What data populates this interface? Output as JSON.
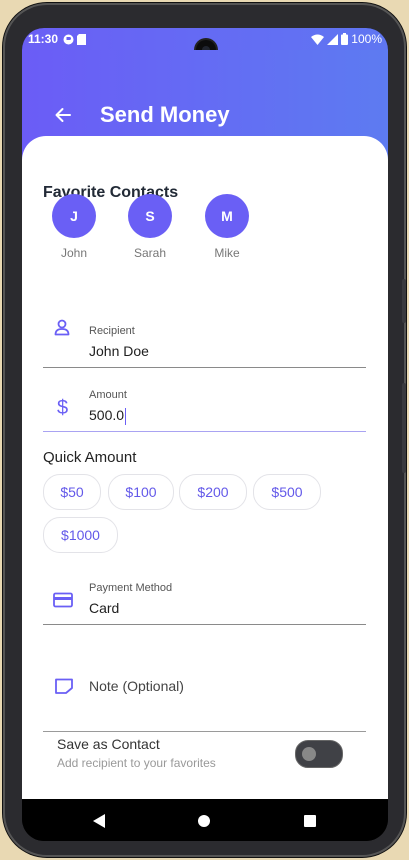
{
  "status_bar": {
    "time": "11:30",
    "battery": "100%"
  },
  "appbar": {
    "title": "Send Money"
  },
  "favorites": {
    "title": "Favorite Contacts",
    "contacts": [
      {
        "initial": "J",
        "name": "John"
      },
      {
        "initial": "S",
        "name": "Sarah"
      },
      {
        "initial": "M",
        "name": "Mike"
      }
    ]
  },
  "recipient": {
    "label": "Recipient",
    "value": "John Doe"
  },
  "amount": {
    "label": "Amount",
    "value": "500.0",
    "currency_symbol": "$"
  },
  "quick_amount": {
    "title": "Quick Amount",
    "options": [
      "$50",
      "$100",
      "$200",
      "$500",
      "$1000"
    ]
  },
  "payment_method": {
    "label": "Payment Method",
    "value": "Card"
  },
  "note": {
    "placeholder": "Note (Optional)"
  },
  "save_contact": {
    "title": "Save as Contact",
    "subtitle": "Add recipient to your favorites",
    "enabled": false
  },
  "colors": {
    "accent": "#6a5ff5",
    "accent_gradient_end": "#5d7bf1"
  }
}
